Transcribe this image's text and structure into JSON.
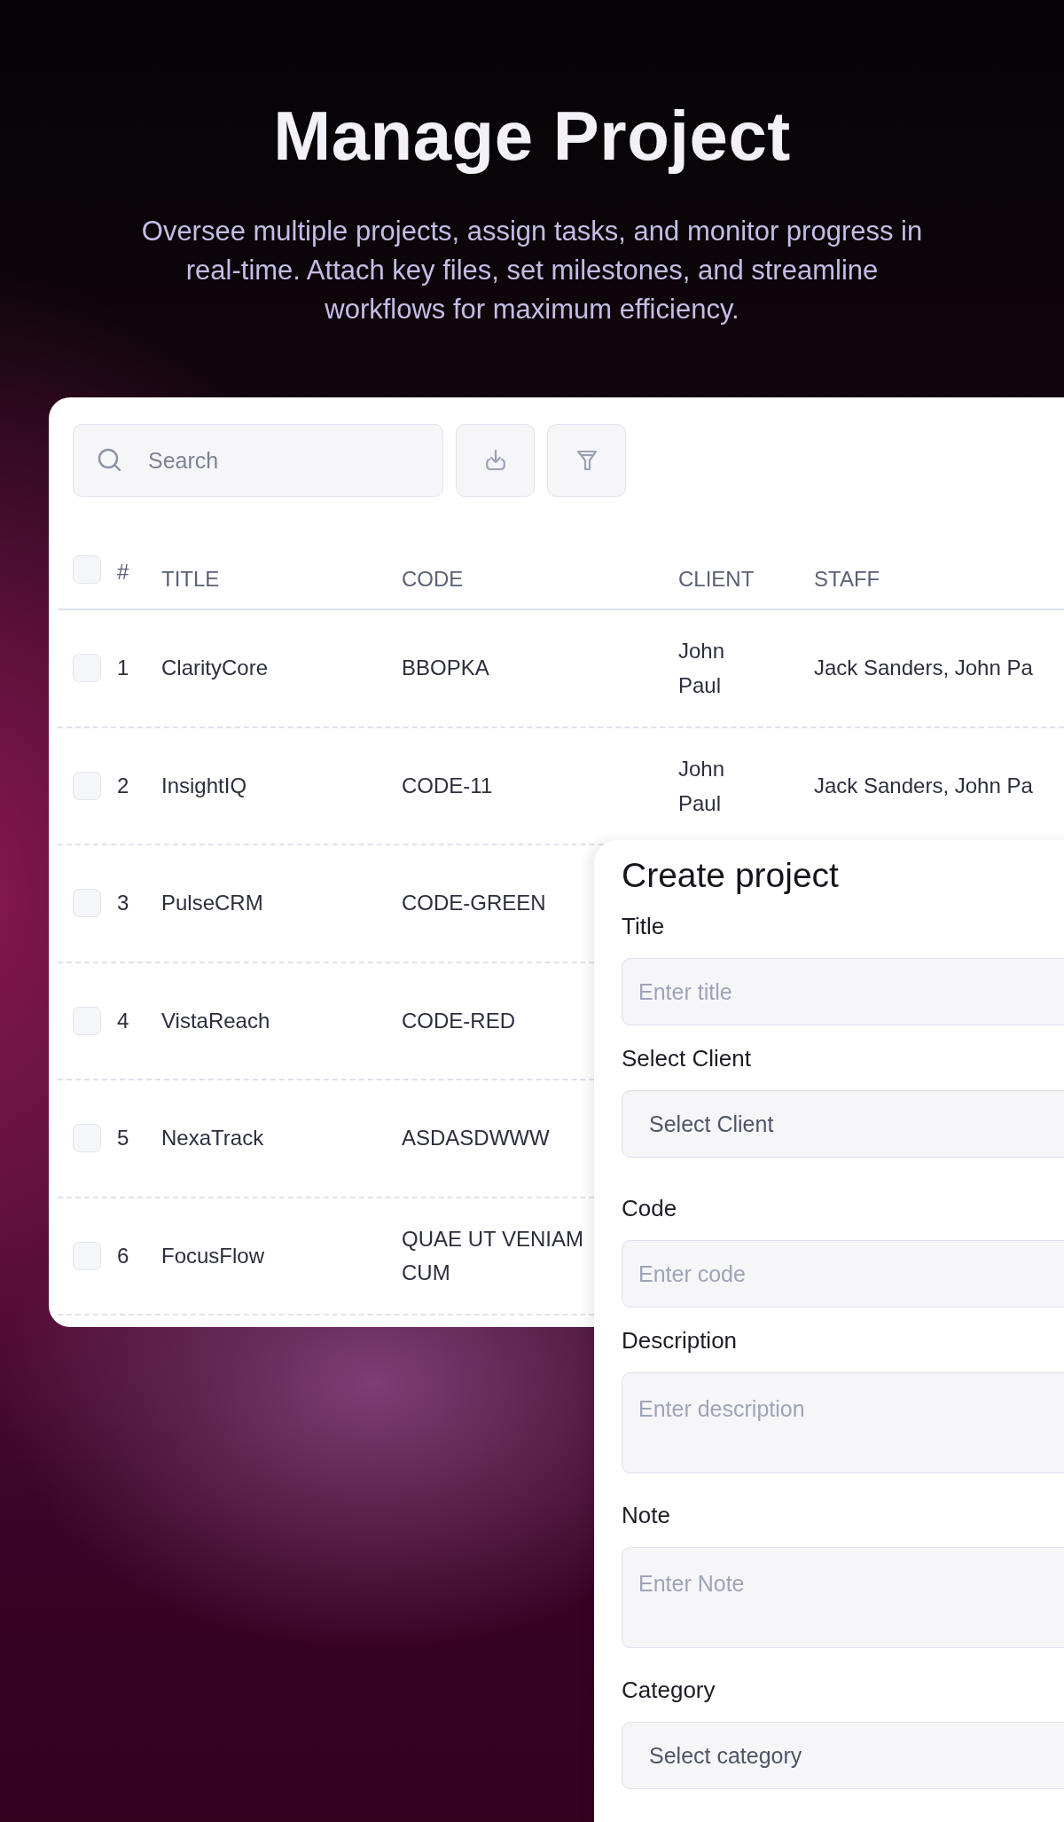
{
  "hero": {
    "title": "Manage Project",
    "subtitle": "Oversee multiple projects, assign tasks, and monitor progress in real-time. Attach key files, set milestones, and streamline workflows for maximum efficiency."
  },
  "toolbar": {
    "search": {
      "placeholder": "Search"
    }
  },
  "table": {
    "header_checkbox": {
      "checked": false
    },
    "columns": [
      "#",
      "TITLE",
      "CODE",
      "CLIENT",
      "STAFF"
    ],
    "rows": [
      {
        "checked": false,
        "number": "1",
        "title": "ClarityCore",
        "code": "BBOPKA",
        "client": "John Paul",
        "staff": "Jack Sanders, John Pa"
      },
      {
        "checked": false,
        "number": "2",
        "title": "InsightIQ",
        "code": "CODE-11",
        "client": "John Paul",
        "staff": "Jack Sanders, John Pa"
      },
      {
        "checked": false,
        "number": "3",
        "title": "PulseCRM",
        "code": "CODE-GREEN"
      },
      {
        "checked": false,
        "number": "4",
        "title": "VistaReach",
        "code": "CODE-RED"
      },
      {
        "checked": false,
        "number": "5",
        "title": "NexaTrack",
        "code": "ASDASDWWW"
      },
      {
        "checked": false,
        "number": "6",
        "title": "FocusFlow",
        "code": "QUAE UT VENIAM CUM"
      }
    ]
  },
  "form": {
    "title": "Create project",
    "fields": [
      {
        "kind": "input",
        "label": "Title",
        "placeholder": "Enter title"
      },
      {
        "kind": "select",
        "label": "Select Client",
        "value": "Select Client"
      },
      {
        "kind": "input",
        "label": "Code",
        "placeholder": "Enter code"
      },
      {
        "kind": "textarea",
        "label": "Description",
        "placeholder": "Enter description"
      },
      {
        "kind": "textarea",
        "label": "Note",
        "placeholder": "Enter Note"
      },
      {
        "kind": "select",
        "label": "Category",
        "value": "Select category"
      }
    ]
  }
}
